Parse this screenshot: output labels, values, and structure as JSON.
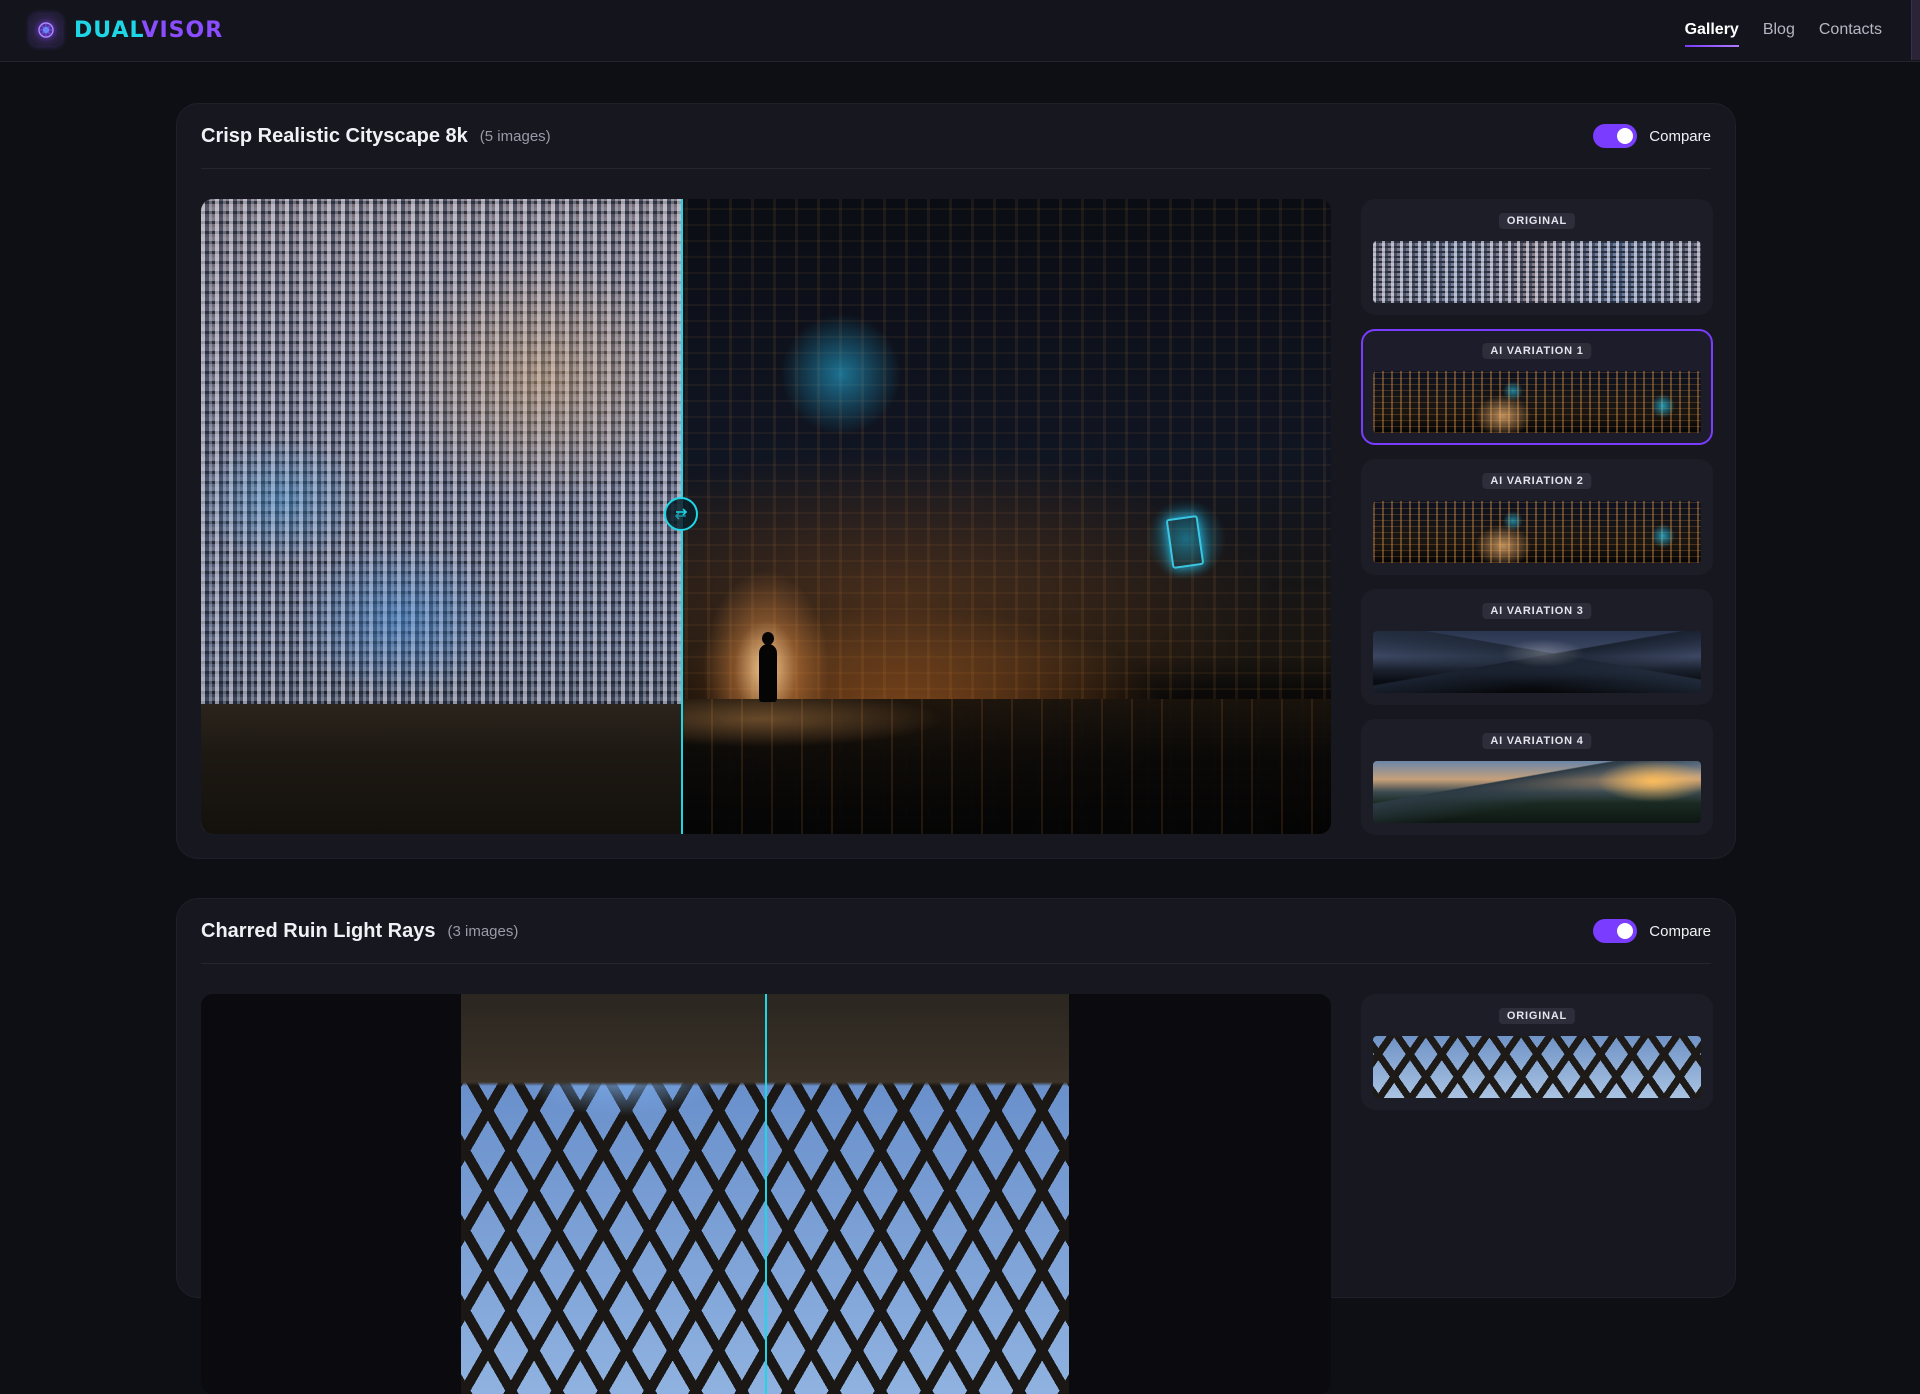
{
  "brand": {
    "part1": "DUAL",
    "part2": "VISOR"
  },
  "nav": {
    "items": [
      {
        "label": "Gallery",
        "active": true
      },
      {
        "label": "Blog",
        "active": false
      },
      {
        "label": "Contacts",
        "active": false
      }
    ]
  },
  "gallery": [
    {
      "title": "Crisp Realistic Cityscape 8k",
      "count": "(5 images)",
      "compare_label": "Compare",
      "compare_on": true,
      "thumbnails": [
        {
          "label": "ORIGINAL",
          "selected": false
        },
        {
          "label": "AI VARIATION 1",
          "selected": true
        },
        {
          "label": "AI VARIATION 2",
          "selected": false
        },
        {
          "label": "AI VARIATION 3",
          "selected": false
        },
        {
          "label": "AI VARIATION 4",
          "selected": false
        }
      ]
    },
    {
      "title": "Charred Ruin Light Rays",
      "count": "(3 images)",
      "compare_label": "Compare",
      "compare_on": true,
      "thumbnails": [
        {
          "label": "ORIGINAL",
          "selected": false
        }
      ]
    }
  ],
  "colors": {
    "accent_cyan": "#1ed6e6",
    "accent_purple": "#7a3cff",
    "bg": "#0e0f15",
    "card": "#16171f"
  }
}
